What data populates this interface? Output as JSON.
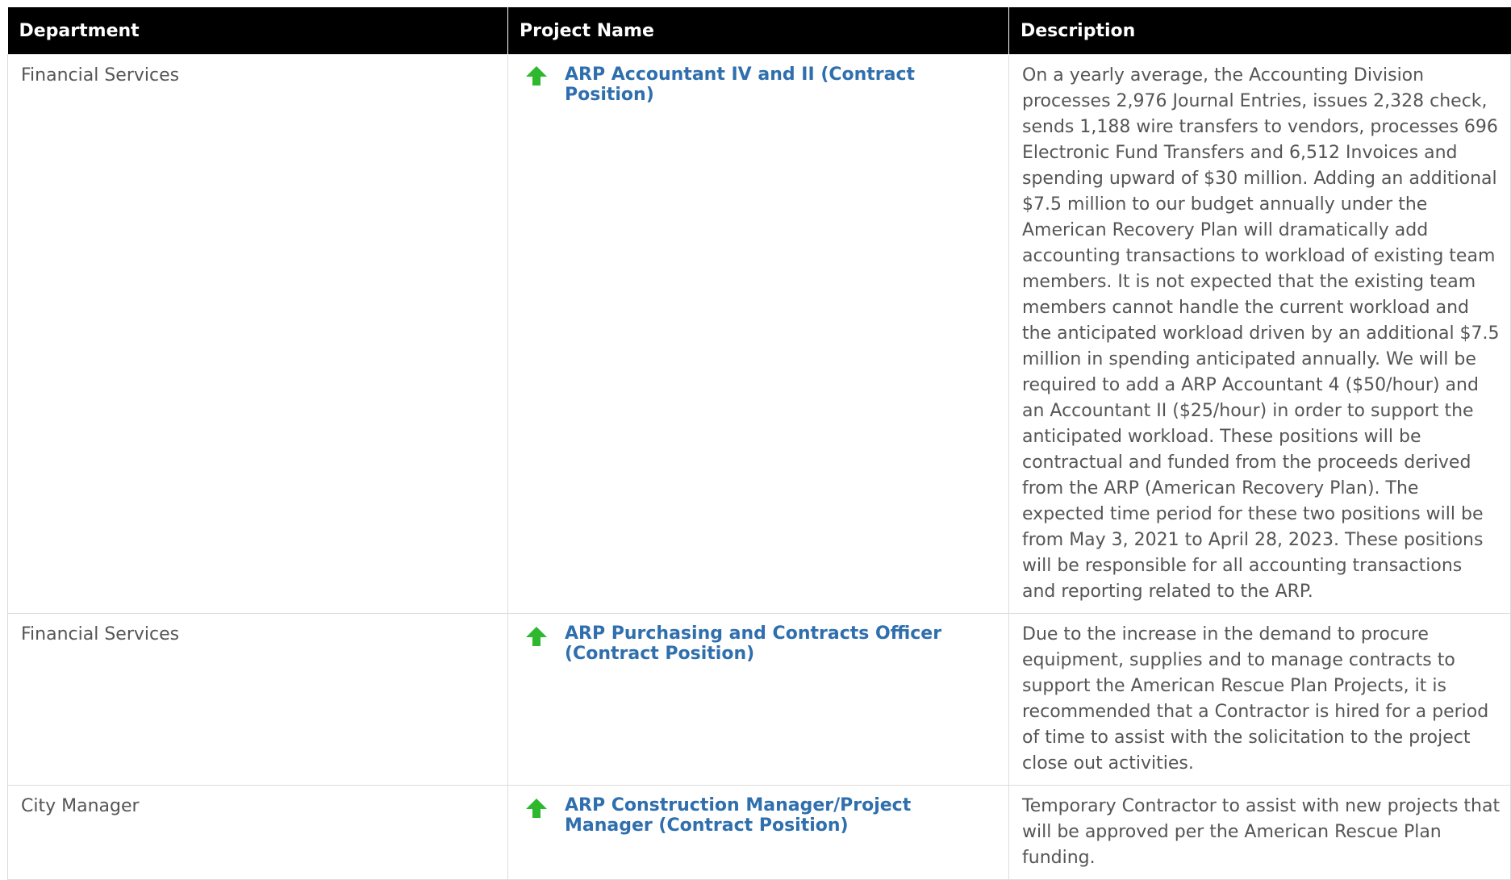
{
  "table": {
    "headers": {
      "department": "Department",
      "project_name": "Project Name",
      "description": "Description"
    },
    "rows": [
      {
        "department": "Financial Services",
        "project": "ARP Accountant IV and II (Contract Position)",
        "description": "On a yearly average, the Accounting Division processes 2,976 Journal Entries, issues 2,328 check, sends 1,188 wire transfers to vendors, processes 696 Electronic Fund Transfers and 6,512 Invoices and spending upward of $30 million. Adding an additional $7.5 million to our budget annually under the American Recovery Plan will dramatically add accounting transactions to workload of existing team members. It is not expected that the existing team members cannot handle the current workload and the anticipated workload driven by an additional $7.5 million in spending anticipated annually. We will be required to add a ARP Accountant 4 ($50/hour) and an Accountant II ($25/hour) in order to support the anticipated workload. These positions will be contractual and funded from the proceeds derived from the ARP (American Recovery Plan). The expected time period for these two positions will be from May 3, 2021 to April 28, 2023. These positions will be responsible for all accounting transactions and reporting related to the ARP."
      },
      {
        "department": "Financial Services",
        "project": "ARP Purchasing and Contracts Officer (Contract Position)",
        "description": "Due to the increase in the demand to procure equipment, supplies and to manage contracts to support the American Rescue Plan Projects, it is recommended that a Contractor is hired for a period of time to assist with the solicitation to the project close out activities."
      },
      {
        "department": "City Manager",
        "project": "ARP Construction Manager/Project Manager (Contract Position)",
        "description": "Temporary Contractor to assist with new projects that will be approved per the American Rescue Plan funding."
      }
    ]
  },
  "icons": {
    "status": "green-up-arrow-icon",
    "status_color": "#2db82d"
  },
  "colors": {
    "header_bg": "#000000",
    "header_text": "#ffffff",
    "link": "#2f6fad",
    "body_text": "#555555",
    "border": "#dcdcdc"
  }
}
